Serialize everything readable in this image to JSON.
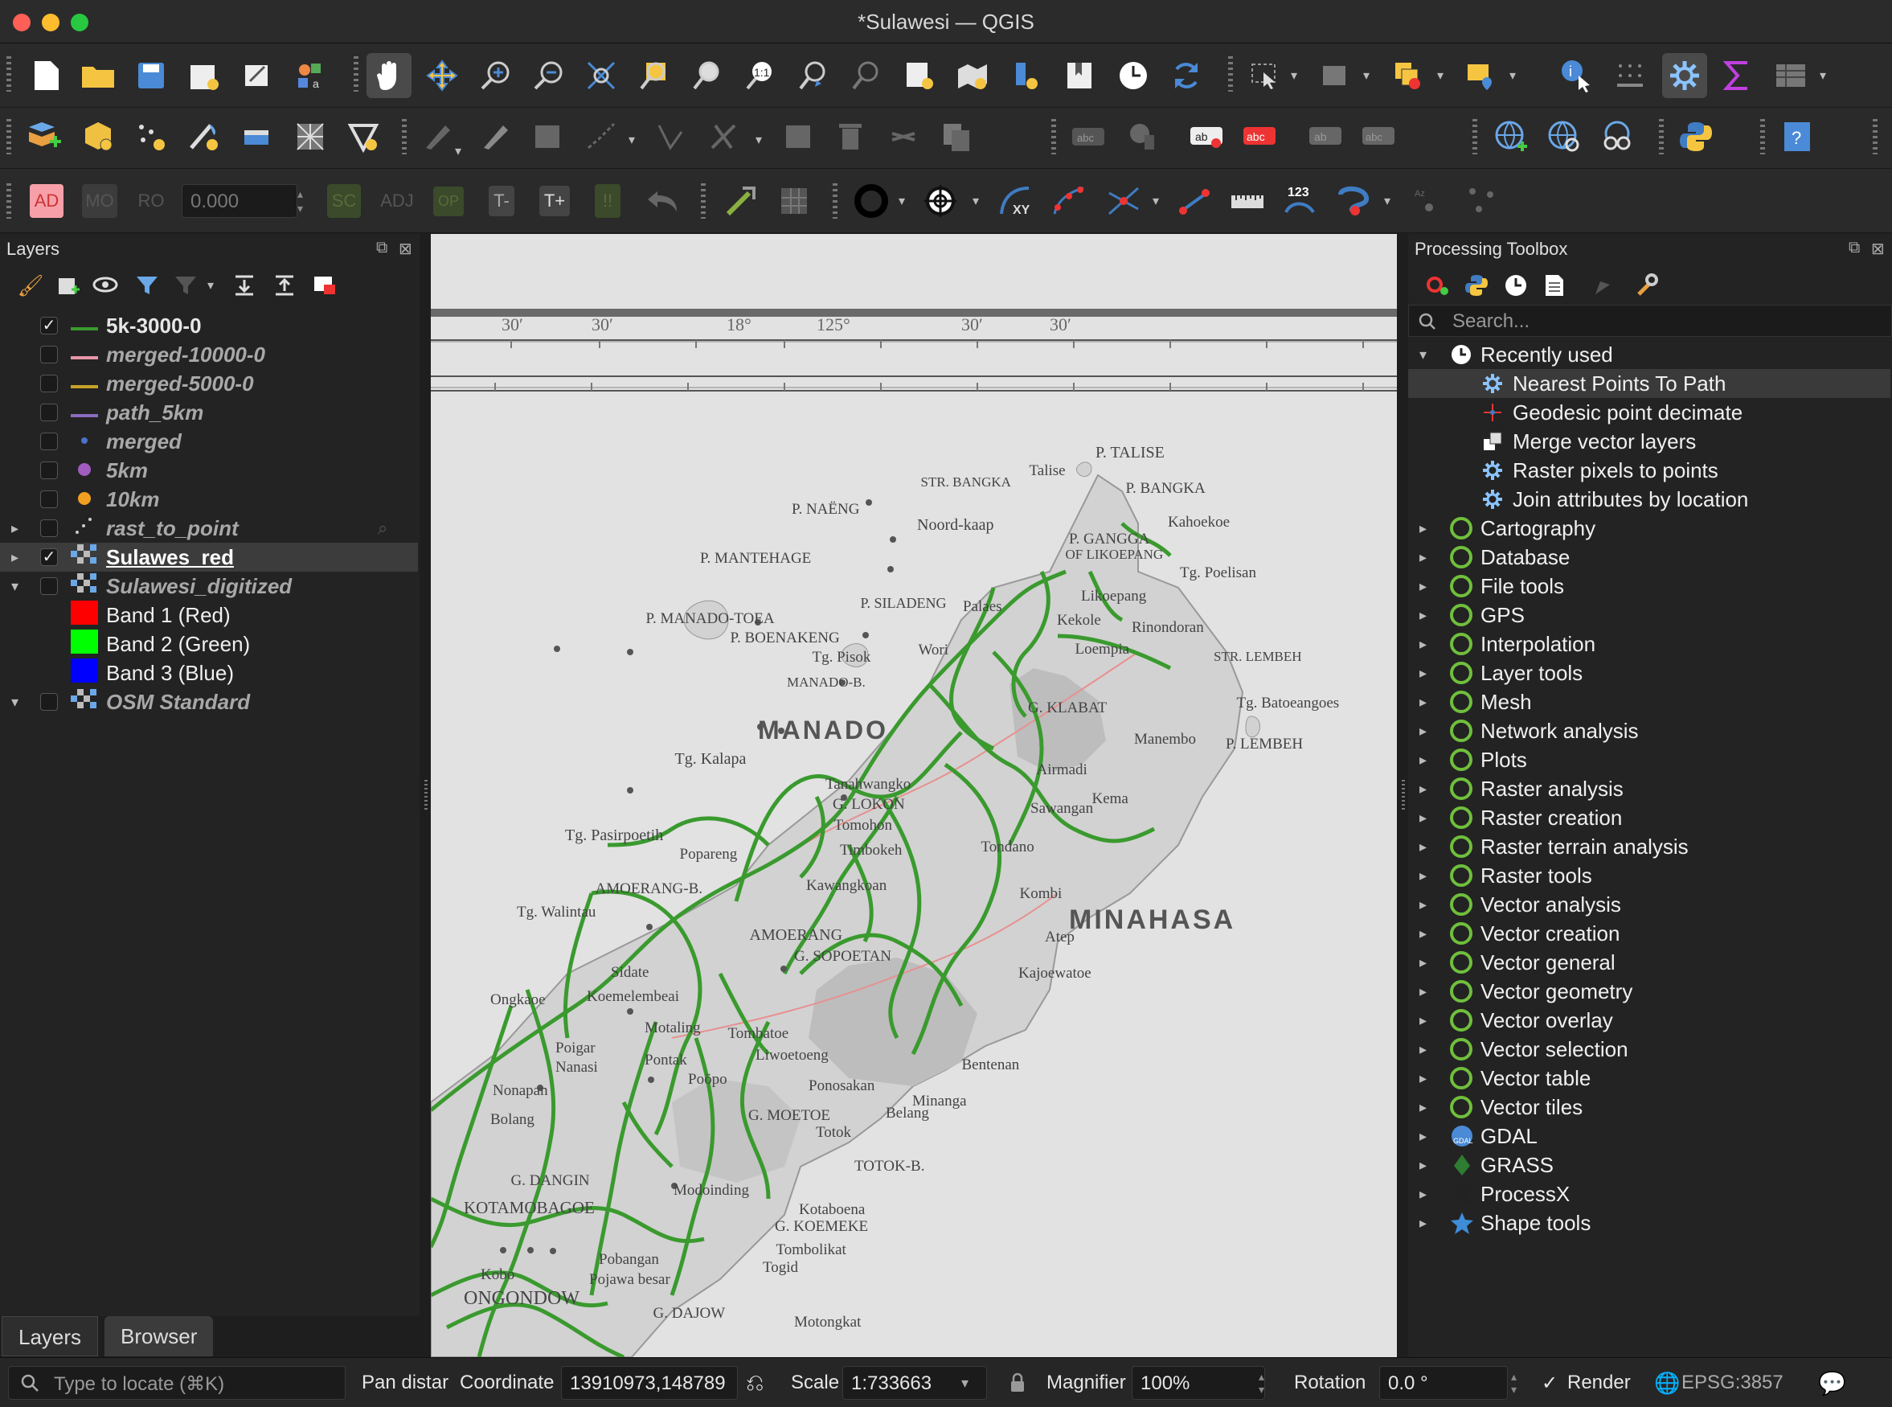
{
  "window": {
    "title": "*Sulawesi — QGIS"
  },
  "toolbar3": {
    "ad": "AD",
    "mo": "MO",
    "ro": "RO",
    "offset": "0.000",
    "sc": "SC",
    "adj": "ADJ",
    "op": "OP",
    "tminus": "T-",
    "tplus": "T+",
    "num": "123"
  },
  "layers_panel": {
    "title": "Layers",
    "items": [
      {
        "name": "5k-3000-0",
        "checked": true,
        "style": "bold",
        "symbol": "line",
        "color": "#3a9a2e"
      },
      {
        "name": "merged-10000-0",
        "checked": false,
        "style": "italic",
        "symbol": "line",
        "color": "#e896a8"
      },
      {
        "name": "merged-5000-0",
        "checked": false,
        "style": "italic",
        "symbol": "line",
        "color": "#c9a227"
      },
      {
        "name": "path_5km",
        "checked": false,
        "style": "italic",
        "symbol": "line",
        "color": "#8a6bbf"
      },
      {
        "name": "merged",
        "checked": false,
        "style": "italic",
        "symbol": "point",
        "color": "#4a72c9"
      },
      {
        "name": "5km",
        "checked": false,
        "style": "italic",
        "symbol": "point",
        "color": "#a05cbf"
      },
      {
        "name": "10km",
        "checked": false,
        "style": "italic",
        "symbol": "point",
        "color": "#f0a020"
      },
      {
        "name": "rast_to_point",
        "checked": false,
        "style": "italic",
        "symbol": "dots",
        "color": "#cccccc"
      },
      {
        "name": "Sulawes_red",
        "checked": true,
        "style": "underline",
        "symbol": "raster",
        "color": "#bbbbbb"
      },
      {
        "name": "Sulawesi_digitized",
        "checked": false,
        "style": "italic",
        "symbol": "raster",
        "color": "#bbbbbb"
      },
      {
        "name": "Band 1 (Red)",
        "checked": null,
        "style": "band",
        "symbol": "swatch",
        "color": "#ff0000"
      },
      {
        "name": "Band 2 (Green)",
        "checked": null,
        "style": "band",
        "symbol": "swatch",
        "color": "#00ff00"
      },
      {
        "name": "Band 3 (Blue)",
        "checked": null,
        "style": "band",
        "symbol": "swatch",
        "color": "#0000ff"
      },
      {
        "name": "OSM Standard",
        "checked": false,
        "style": "italic",
        "symbol": "raster",
        "color": "#bbbbbb"
      }
    ],
    "tabs": [
      "Layers",
      "Browser"
    ]
  },
  "toolbox": {
    "title": "Processing Toolbox",
    "search_placeholder": "Search...",
    "recent": "Recently used",
    "recent_items": [
      "Nearest Points To Path",
      "Geodesic point decimate",
      "Merge vector layers",
      "Raster pixels to points",
      "Join attributes by location"
    ],
    "groups": [
      "Cartography",
      "Database",
      "File tools",
      "GPS",
      "Interpolation",
      "Layer tools",
      "Mesh",
      "Network analysis",
      "Plots",
      "Raster analysis",
      "Raster creation",
      "Raster terrain analysis",
      "Raster tools",
      "Vector analysis",
      "Vector creation",
      "Vector general",
      "Vector geometry",
      "Vector overlay",
      "Vector selection",
      "Vector table",
      "Vector tiles"
    ],
    "providers": [
      "GDAL",
      "GRASS",
      "ProcessX",
      "Shape tools"
    ]
  },
  "status": {
    "locate_placeholder": "Type to locate (⌘K)",
    "pan": "Pan distar",
    "coord_label": "Coordinate",
    "coord": "13910973,148789",
    "scale_label": "Scale",
    "scale": "1:733663",
    "magnifier_label": "Magnifier",
    "magnifier": "100%",
    "rotation_label": "Rotation",
    "rotation": "0.0 °",
    "render": "Render",
    "crs": "EPSG:3857"
  },
  "map": {
    "border_labels": [
      "30′",
      "30′",
      "18°",
      "125°",
      "30′",
      "30′"
    ],
    "labels": [
      "P. TALISE",
      "Talise",
      "P. BANGKA",
      "P. NAËNG",
      "Noord-kaap",
      "Kahoekoe",
      "P. GANGGA",
      "STR. BANGKA",
      "OF LIKOEPANG",
      "Tg. Poelisan",
      "P. MANTEHAGE",
      "P. SILADENG",
      "Likoepang",
      "Palaes",
      "Kekole",
      "Rinondoran",
      "Loempia",
      "P. MANADO-TOEA",
      "P. BOENAKENG",
      "Wori",
      "Tg. Pisok",
      "MANADO-B.",
      "MANADO",
      "G. KLABAT",
      "Manembo",
      "Tg. Batoeangoes",
      "P. LEMBEH",
      "STR. LEMBEH",
      "Tg. Kalapa",
      "Tanahwangko",
      "G. LOKON",
      "Tomohon",
      "Airmadi",
      "Kema",
      "Sawangan",
      "Tg. Pasirpoetih",
      "Popareng",
      "Timbokeh",
      "Tondano",
      "MINAHASA",
      "AMOERANG-B.",
      "Tg. Walintau",
      "Kawangkoan",
      "AMOERANG",
      "G. SOPOETAN",
      "Atep",
      "Kombi",
      "Kajoewatoe",
      "Sidate",
      "Koemelembeai",
      "Ongkaoe",
      "Motaling",
      "Tombatoe",
      "Liwoetoeng",
      "Poigar",
      "Nanasi",
      "Pontak",
      "Poöpo",
      "Ponosakan",
      "Bentenan",
      "Minanga",
      "Belang",
      "G. MOETOE",
      "Totok",
      "TOTOK-B.",
      "Nonapan",
      "Bolang",
      "G. DANGIN",
      "Modoinding",
      "KOTAMOBAGOE",
      "Kotaboena",
      "G. KOEMEKE",
      "Tombolikat",
      "Togid",
      "Pobangan",
      "Pojawa besar",
      "ONGONDOW",
      "G. DAJOW",
      "Motongkat",
      "Kobo",
      "MINAHASA"
    ]
  }
}
